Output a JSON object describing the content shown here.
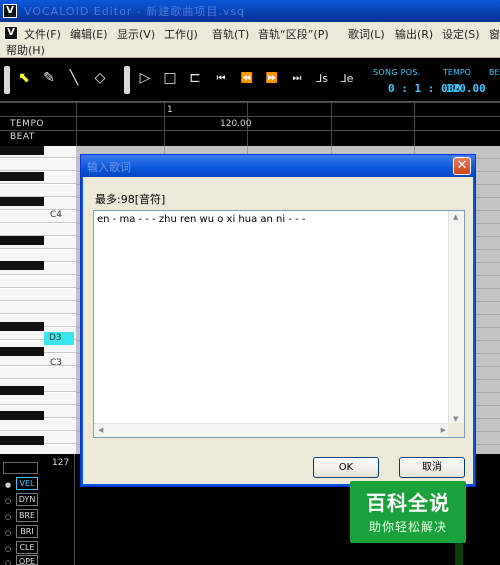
{
  "window": {
    "title": "VOCALOID Editor - 新建歌曲项目.vsq"
  },
  "menu": {
    "items": [
      "文件(F)",
      "编辑(E)",
      "显示(V)",
      "工作(J)",
      "音轨(T)",
      "音轨“区段”(P)",
      "歌词(L)",
      "输出(R)",
      "设定(S)",
      "窗"
    ],
    "help": "帮助(H)"
  },
  "toolbar": {
    "tools": [
      {
        "name": "arrow-icon",
        "glyph": "⬉",
        "selected": true
      },
      {
        "name": "pencil-icon",
        "glyph": "✎",
        "selected": false
      },
      {
        "name": "line-icon",
        "glyph": "╲",
        "selected": false
      },
      {
        "name": "eraser-icon",
        "glyph": "◇",
        "selected": false
      }
    ],
    "transport": [
      {
        "name": "play-icon",
        "glyph": "▷"
      },
      {
        "name": "stop-icon",
        "glyph": "□"
      },
      {
        "name": "loop-icon",
        "glyph": "⊏"
      },
      {
        "name": "go-to-start-icon",
        "glyph": "⏮"
      },
      {
        "name": "rewind-icon",
        "glyph": "⏪"
      },
      {
        "name": "fast-forward-icon",
        "glyph": "⏩"
      },
      {
        "name": "go-to-end-icon",
        "glyph": "⏭"
      },
      {
        "name": "start-marker-icon",
        "glyph": "⅃s"
      },
      {
        "name": "end-marker-icon",
        "glyph": "⅃e"
      }
    ],
    "song_pos_label": "SONG POS.",
    "song_pos_value": "0 : 1 : 000",
    "tempo_label": "TEMPO",
    "tempo_value": "120.00",
    "beat_label": "BE"
  },
  "ruler": {
    "tempo_label": "TEMPO",
    "beat_label": "BEAT",
    "measure": "1",
    "tempo_value": "120.00"
  },
  "piano": {
    "labels": {
      "c4": "C4",
      "d3": "D3",
      "c3": "C3"
    }
  },
  "control": {
    "max_value": "127",
    "tabs": [
      "VEL",
      "DYN",
      "BRE",
      "BRI",
      "CLE",
      "OPE"
    ],
    "active_tab": "VEL"
  },
  "dialog": {
    "title": "输入歌词",
    "limit_text": "最多:98[音符]",
    "lyrics": "en - ma - - - zhu ren wu o xi hua an ni - - -",
    "ok_label": "OK",
    "cancel_label": "取消"
  },
  "watermark": {
    "title": "百科全说",
    "subtitle": "助你轻松解决"
  },
  "colors": {
    "accent_cyan": "#3ec8ff",
    "highlight_key": "#39e6f0",
    "titlebar_blue": "#0a55d8",
    "watermark_green": "#1aa23a"
  }
}
